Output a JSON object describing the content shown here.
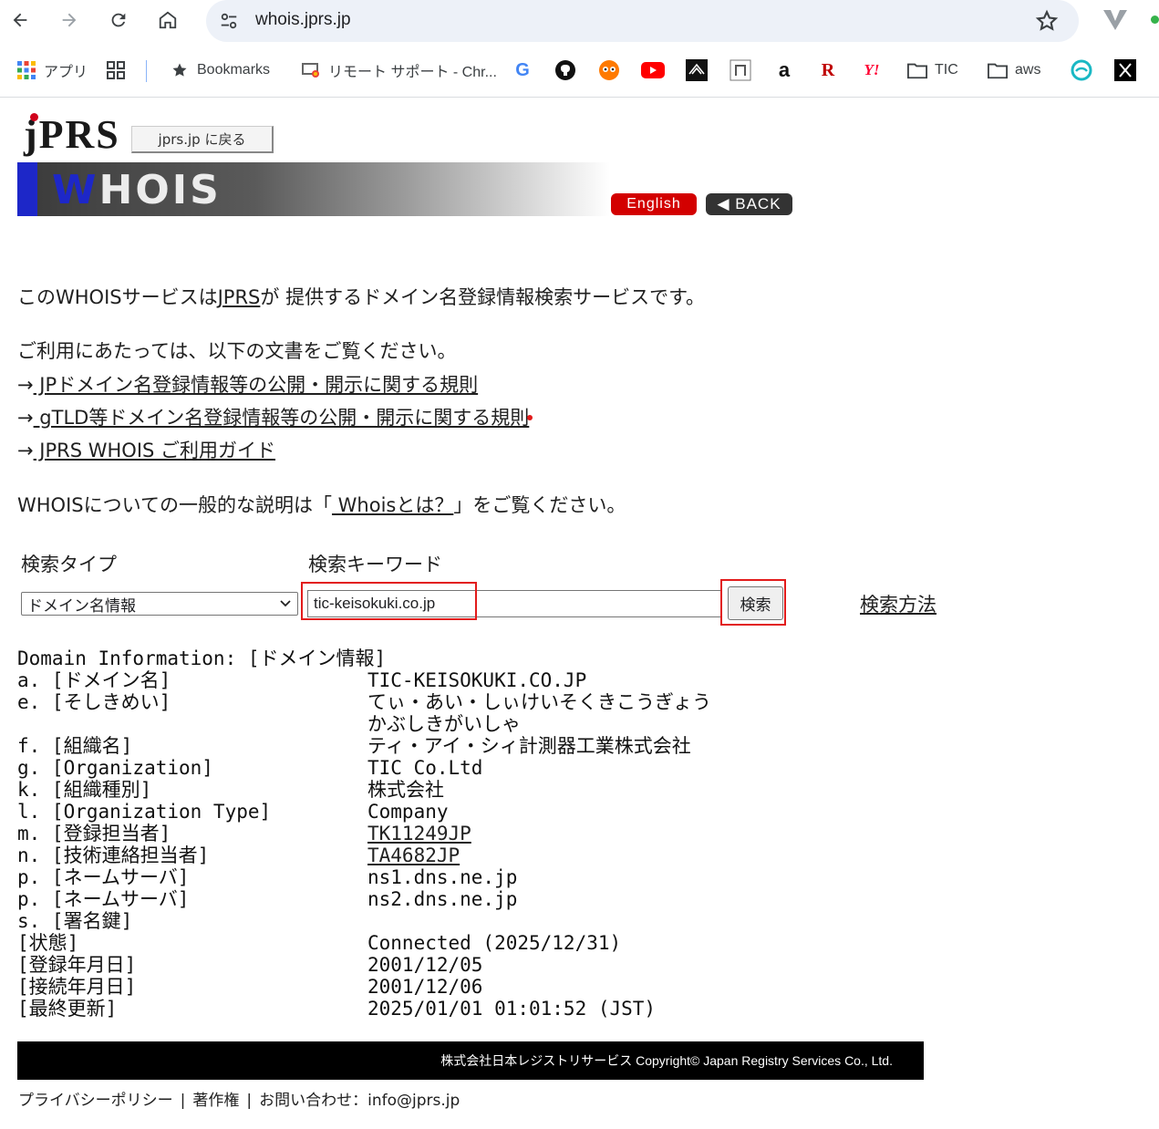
{
  "browser": {
    "url": "whois.jprs.jp",
    "bookmarks": {
      "apps": "アプリ",
      "bookmarks": "Bookmarks",
      "remote": "リモート サポート - Chr...",
      "tic": "TIC",
      "aws": "aws"
    }
  },
  "header": {
    "logo": "jPRS",
    "back_to_jprs": "jprs.jp に戻る",
    "banner": "WHOIS",
    "english": "English",
    "back": "◀ BACK"
  },
  "intro": {
    "line1_pre": "このWHOISサービスは",
    "line1_link": "JPRS",
    "line1_post": "が 提供するドメイン名登録情報検索サービスです。",
    "line2": "ご利用にあたっては、以下の文書をご覧ください。",
    "arrow": "→",
    "rule1": " JPドメイン名登録情報等の公開・開示に関する規則",
    "rule2": " gTLD等ドメイン名登録情報等の公開・開示に関する規則",
    "rule3": " JPRS WHOIS ご利用ガイド",
    "general_pre": "WHOISについての一般的な説明は「",
    "general_link": " Whoisとは？",
    "general_post": "」をご覧ください。"
  },
  "search": {
    "type_label": "検索タイプ",
    "keyword_label": "検索キーワード",
    "type_value": "ドメイン名情報",
    "keyword_value": "tic-keisokuki.co.jp",
    "button": "検索",
    "how_to": "検索方法"
  },
  "results": {
    "heading": "Domain Information: [ドメイン情報]",
    "rows": [
      {
        "label": "a. [ドメイン名]",
        "value": "TIC-KEISOKUKI.CO.JP"
      },
      {
        "label": "e. [そしきめい]",
        "value": "てぃ・あい・しぃけいそくきこうぎょう"
      },
      {
        "label": "",
        "value": "かぶしきがいしゃ"
      },
      {
        "label": "f. [組織名]",
        "value": "ティ・アイ・シィ計測器工業株式会社"
      },
      {
        "label": "g. [Organization]",
        "value": "TIC Co.Ltd"
      },
      {
        "label": "k. [組織種別]",
        "value": "株式会社"
      },
      {
        "label": "l. [Organization Type]",
        "value": "Company"
      },
      {
        "label": "m. [登録担当者]",
        "value": "TK11249JP"
      },
      {
        "label": "n. [技術連絡担当者]",
        "value": "TA4682JP"
      },
      {
        "label": "p. [ネームサーバ]",
        "value": "ns1.dns.ne.jp"
      },
      {
        "label": "p. [ネームサーバ]",
        "value": "ns2.dns.ne.jp"
      },
      {
        "label": "s. [署名鍵]",
        "value": ""
      },
      {
        "label": "[状態]",
        "value": "Connected (2025/12/31)"
      },
      {
        "label": "[登録年月日]",
        "value": "2001/12/05"
      },
      {
        "label": "[接続年月日]",
        "value": "2001/12/06"
      },
      {
        "label": "[最終更新]",
        "value": "2025/01/01 01:01:52 (JST)"
      }
    ]
  },
  "footer": {
    "copyright": "株式会社日本レジストリサービス Copyright© Japan Registry Services Co., Ltd.",
    "privacy": "プライバシーポリシー",
    "copyright_link": "著作権",
    "contact": "お問い合わせ：info@jprs.jp",
    "sep": "|"
  },
  "colors": {
    "highlight": "#e21b1b",
    "banner_blue": "#1d27c8",
    "english_red": "#d30000"
  }
}
